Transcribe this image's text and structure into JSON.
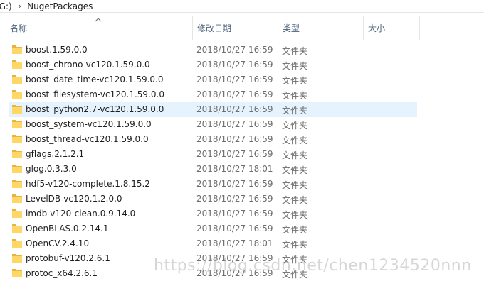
{
  "address": {
    "drive": "(G:)",
    "folder": "NugetPackages",
    "separator": "›"
  },
  "columns": {
    "name": "名称",
    "date": "修改日期",
    "type": "类型",
    "size": "大小",
    "sort_icon": "sort-ascending-icon"
  },
  "colors": {
    "folder_body": "#ffd766",
    "folder_tab": "#e8b33f",
    "selected_row": "#e5f3ff",
    "header_text": "#4c607a"
  },
  "selected_index": 4,
  "files": [
    {
      "name": "boost.1.59.0.0",
      "date": "2018/10/27 16:59",
      "type": "文件夹"
    },
    {
      "name": "boost_chrono-vc120.1.59.0.0",
      "date": "2018/10/27 16:59",
      "type": "文件夹"
    },
    {
      "name": "boost_date_time-vc120.1.59.0.0",
      "date": "2018/10/27 16:59",
      "type": "文件夹"
    },
    {
      "name": "boost_filesystem-vc120.1.59.0.0",
      "date": "2018/10/27 16:59",
      "type": "文件夹"
    },
    {
      "name": "boost_python2.7-vc120.1.59.0.0",
      "date": "2018/10/27 16:59",
      "type": "文件夹"
    },
    {
      "name": "boost_system-vc120.1.59.0.0",
      "date": "2018/10/27 16:59",
      "type": "文件夹"
    },
    {
      "name": "boost_thread-vc120.1.59.0.0",
      "date": "2018/10/27 16:59",
      "type": "文件夹"
    },
    {
      "name": "gflags.2.1.2.1",
      "date": "2018/10/27 16:59",
      "type": "文件夹"
    },
    {
      "name": "glog.0.3.3.0",
      "date": "2018/10/27 18:01",
      "type": "文件夹"
    },
    {
      "name": "hdf5-v120-complete.1.8.15.2",
      "date": "2018/10/27 16:59",
      "type": "文件夹"
    },
    {
      "name": "LevelDB-vc120.1.2.0.0",
      "date": "2018/10/27 16:59",
      "type": "文件夹"
    },
    {
      "name": "lmdb-v120-clean.0.9.14.0",
      "date": "2018/10/27 16:59",
      "type": "文件夹"
    },
    {
      "name": "OpenBLAS.0.2.14.1",
      "date": "2018/10/27 16:59",
      "type": "文件夹"
    },
    {
      "name": "OpenCV.2.4.10",
      "date": "2018/10/27 18:01",
      "type": "文件夹"
    },
    {
      "name": "protobuf-v120.2.6.1",
      "date": "2018/10/27 16:59",
      "type": "文件夹"
    },
    {
      "name": "protoc_x64.2.6.1",
      "date": "2018/10/27 16:59",
      "type": "文件夹"
    }
  ],
  "watermark": "https://blog.csdn.net/chen1234520nnn"
}
